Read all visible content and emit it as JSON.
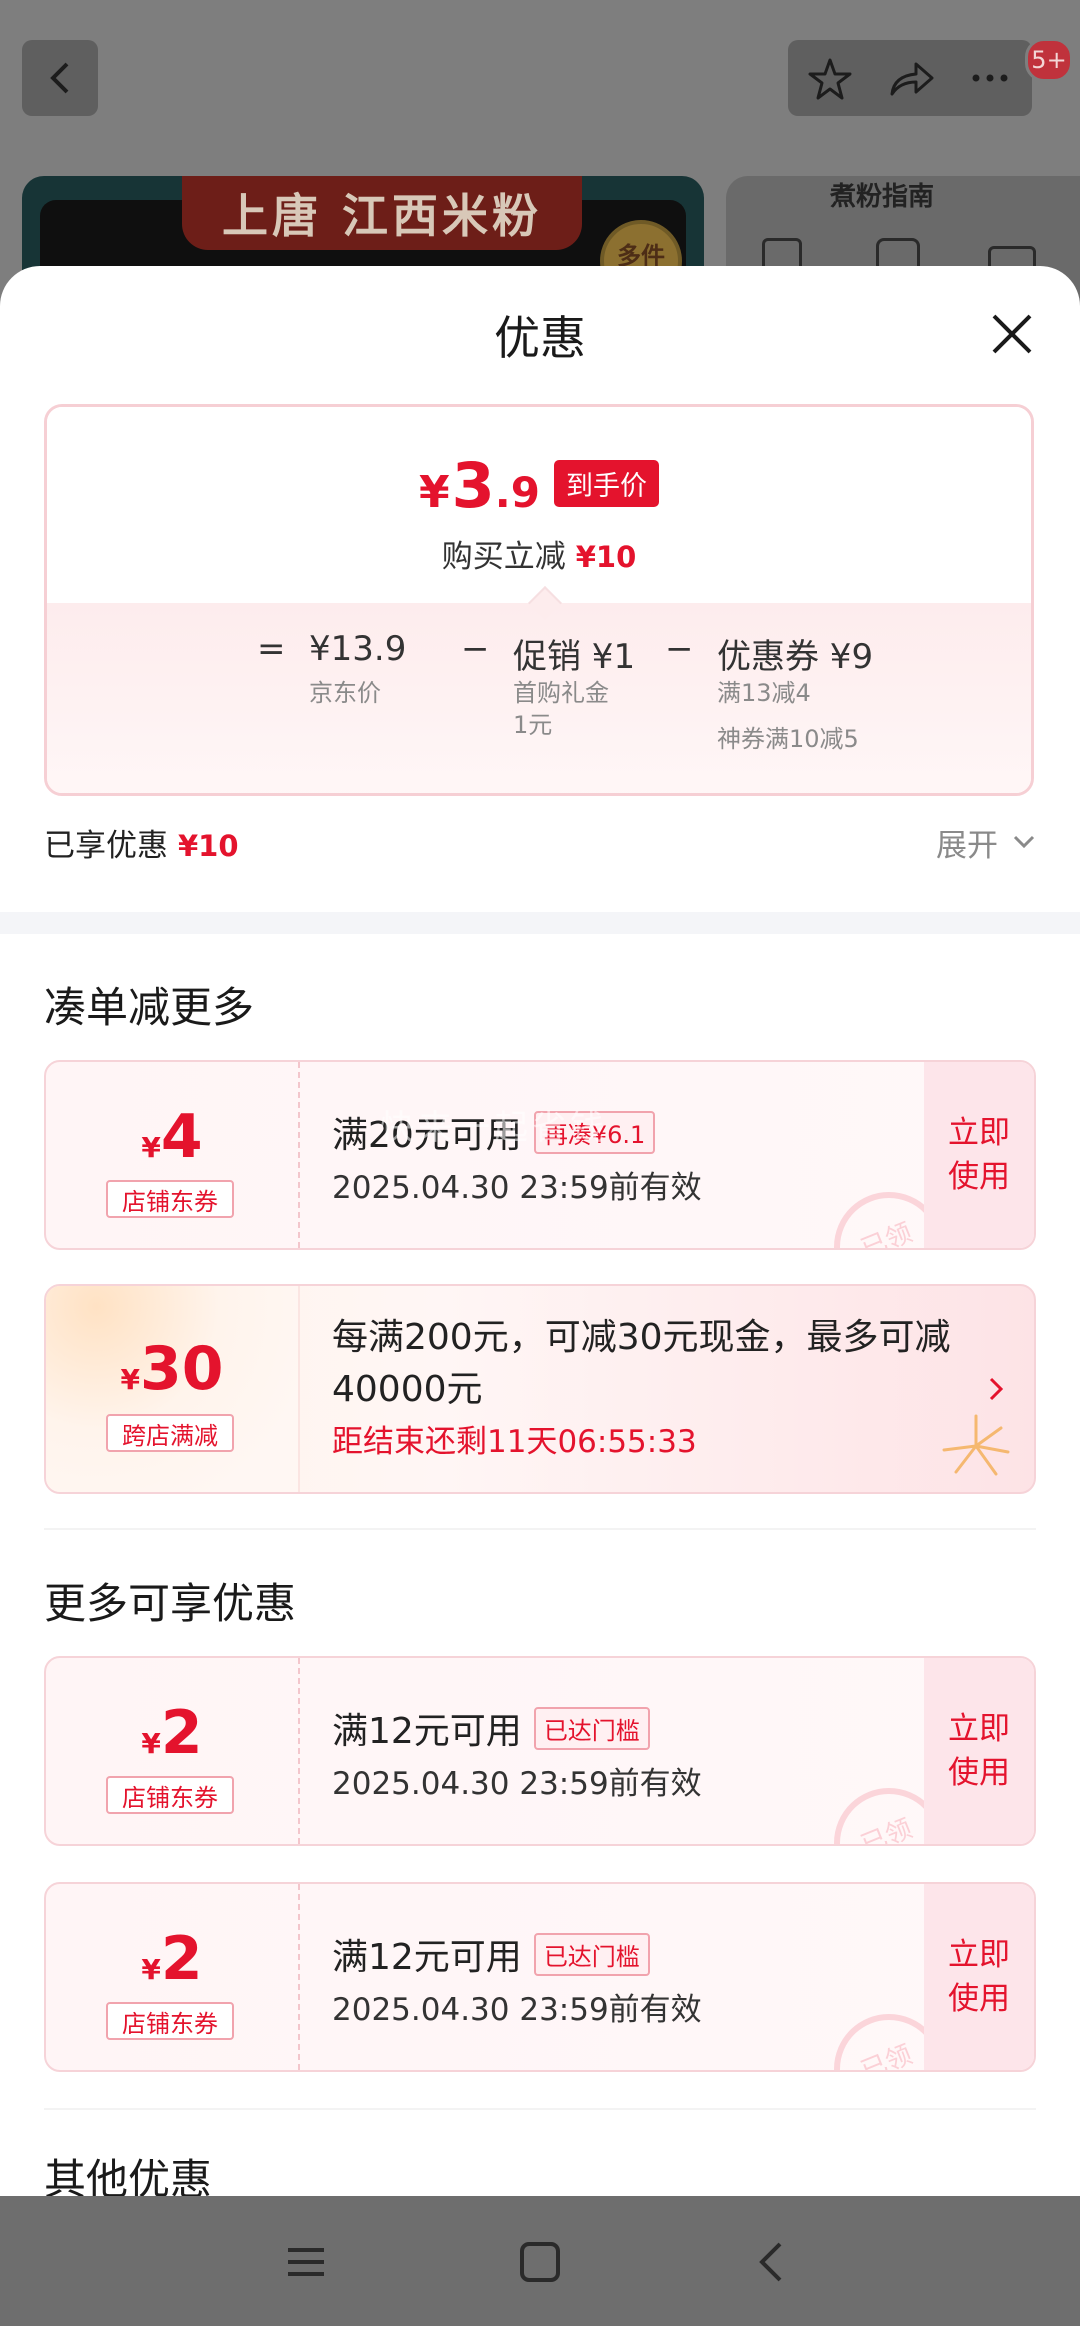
{
  "background": {
    "notification_badge": "5+",
    "banner_title": "上唐 江西米粉",
    "banner_seal": "多件",
    "guide_title": "煮粉指南"
  },
  "sheet": {
    "title": "优惠",
    "price": {
      "yen": "¥",
      "integer": "3",
      "decimal": ".9",
      "tag": "到手价",
      "save_label": "购买立减",
      "save_amount": "¥10"
    },
    "calc": {
      "equals": "=",
      "jd_price": "¥13.9",
      "jd_price_label": "京东价",
      "minus1": "−",
      "promo": "促销 ¥1",
      "promo_sub1": "首购礼金",
      "promo_sub2": "1元",
      "minus2": "−",
      "coupon": "优惠券 ¥9",
      "coupon_sub1": "满13减4",
      "coupon_sub2": "神券满10减5"
    },
    "enjoyed_label": "已享优惠",
    "enjoyed_amount": "¥10",
    "expand_label": "展开"
  },
  "section1": {
    "title": "凑单减更多",
    "coupon": {
      "yen": "¥",
      "amount": "4",
      "type": "店铺东券",
      "condition": "满20元可用",
      "tag": "再凑¥6.1",
      "valid": "2025.04.30 23:59前有效",
      "use_line1": "立即",
      "use_line2": "使用",
      "stamp": "已领"
    },
    "promo": {
      "yen": "¥",
      "amount": "30",
      "type": "跨店满减",
      "desc": "每满200元，可减30元现金，最多可减40000元",
      "timer": "距结束还剩11天06:55:33"
    }
  },
  "section2": {
    "title": "更多可享优惠",
    "coupons": [
      {
        "yen": "¥",
        "amount": "2",
        "type": "店铺东券",
        "condition": "满12元可用",
        "tag": "已达门槛",
        "valid": "2025.04.30 23:59前有效",
        "use_line1": "立即",
        "use_line2": "使用",
        "stamp": "已领"
      },
      {
        "yen": "¥",
        "amount": "2",
        "type": "店铺东券",
        "condition": "满12元可用",
        "tag": "已达门槛",
        "valid": "2025.04.30 23:59前有效",
        "use_line1": "立即",
        "use_line2": "使用",
        "stamp": "已领"
      }
    ]
  },
  "section3": {
    "title": "其他优惠"
  },
  "watermark": "快来一起省钱",
  "colors": {
    "accent": "#e4132d",
    "coupon_bg": "#fff5f6",
    "use_bg": "#fde5ea"
  }
}
